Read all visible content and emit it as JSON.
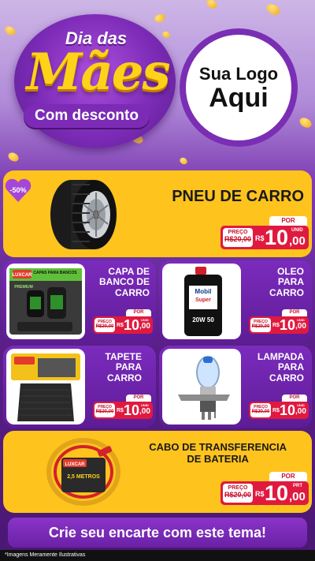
{
  "header": {
    "title_line1": "Dia das",
    "title_line2": "Mães",
    "title_line3": "Com desconto",
    "logo_line1": "Sua Logo",
    "logo_line2": "Aqui"
  },
  "colors": {
    "accent_yellow": "#ffc31e",
    "accent_purple": "#6a2a9c",
    "price_red": "#e01a3f"
  },
  "discount_badge": "-50%",
  "products": [
    {
      "name_lines": [
        "PNEU DE CARRO"
      ],
      "label_preco": "PREÇO",
      "old_price": "R$20,00",
      "label_por": "POR",
      "currency": "R$",
      "price_int": "10",
      "price_cents": ",00",
      "unit": "UNID"
    },
    {
      "name_lines": [
        "CAPA DE",
        "BANCO DE",
        "CARRO"
      ],
      "label_preco": "PREÇO",
      "old_price": "R$20,00",
      "label_por": "POR",
      "currency": "R$",
      "price_int": "10",
      "price_cents": ",00",
      "unit": "UNID"
    },
    {
      "name_lines": [
        "OLEO",
        "PARA",
        "CARRO"
      ],
      "label_preco": "PREÇO",
      "old_price": "R$20,00",
      "label_por": "POR",
      "currency": "R$",
      "price_int": "10",
      "price_cents": ",00",
      "unit": "UNID"
    },
    {
      "name_lines": [
        "TAPETE",
        "PARA",
        "CARRO"
      ],
      "label_preco": "PREÇO",
      "old_price": "R$20,00",
      "label_por": "POR",
      "currency": "R$",
      "price_int": "10",
      "price_cents": ",00",
      "unit": "UNID"
    },
    {
      "name_lines": [
        "LAMPADA",
        "PARA",
        "CARRO"
      ],
      "label_preco": "PREÇO",
      "old_price": "R$20,00",
      "label_por": "POR",
      "currency": "R$",
      "price_int": "10",
      "price_cents": ",00",
      "unit": "UNID"
    },
    {
      "name_lines": [
        "CABO DE TRANSFERENCIA",
        "DE BATERIA"
      ],
      "label_preco": "PREÇO",
      "old_price": "R$20,00",
      "label_por": "POR",
      "currency": "R$",
      "price_int": "10",
      "price_cents": ",00",
      "unit": "PRT"
    }
  ],
  "product_images": {
    "seat_cover_brand": "LUXCAR",
    "seat_cover_label": "CAPAS PARA BANCOS",
    "seat_cover_sub": "PREMIUM",
    "oil_brand": "Mobil",
    "oil_sub": "Super",
    "oil_grade": "20W 50",
    "cable_brand": "LUXCAR",
    "cable_size": "2,5 METROS"
  },
  "cta": "Crie seu encarte com este tema!",
  "footer": "*Imagens Meramente Ilustrativas"
}
